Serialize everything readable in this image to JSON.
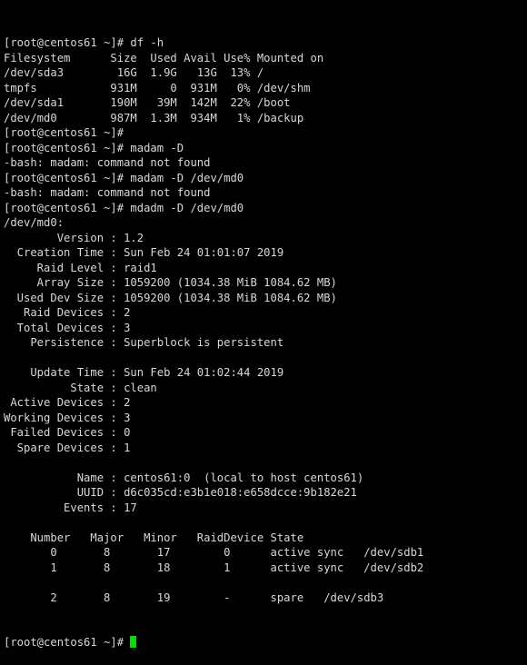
{
  "terminal": {
    "colors": {
      "background": "#000000",
      "foreground": "#d8d8d8",
      "cursor": "#00e000"
    },
    "prompt": "[root@centos61 ~]#",
    "hostname": "centos61",
    "user": "root",
    "lines": [
      "[root@centos61 ~]# df -h",
      "Filesystem      Size  Used Avail Use% Mounted on",
      "/dev/sda3        16G  1.9G   13G  13% /",
      "tmpfs           931M     0  931M   0% /dev/shm",
      "/dev/sda1       190M   39M  142M  22% /boot",
      "/dev/md0        987M  1.3M  934M   1% /backup",
      "[root@centos61 ~]#",
      "[root@centos61 ~]# madam -D",
      "-bash: madam: command not found",
      "[root@centos61 ~]# madam -D /dev/md0",
      "-bash: madam: command not found",
      "[root@centos61 ~]# mdadm -D /dev/md0",
      "/dev/md0:",
      "        Version : 1.2",
      "  Creation Time : Sun Feb 24 01:01:07 2019",
      "     Raid Level : raid1",
      "     Array Size : 1059200 (1034.38 MiB 1084.62 MB)",
      "  Used Dev Size : 1059200 (1034.38 MiB 1084.62 MB)",
      "   Raid Devices : 2",
      "  Total Devices : 3",
      "    Persistence : Superblock is persistent",
      "",
      "    Update Time : Sun Feb 24 01:02:44 2019",
      "          State : clean",
      " Active Devices : 2",
      "Working Devices : 3",
      " Failed Devices : 0",
      "  Spare Devices : 1",
      "",
      "           Name : centos61:0  (local to host centos61)",
      "           UUID : d6c035cd:e3b1e018:e658dcce:9b182e21",
      "         Events : 17",
      "",
      "    Number   Major   Minor   RaidDevice State",
      "       0       8       17        0      active sync   /dev/sdb1",
      "       1       8       18        1      active sync   /dev/sdb2",
      "",
      "       2       8       19        -      spare   /dev/sdb3"
    ],
    "final_prompt": "[root@centos61 ~]# ",
    "commands": [
      "df -h",
      "madam -D",
      "madam -D /dev/md0",
      "mdadm -D /dev/md0"
    ],
    "errors": [
      "-bash: madam: command not found",
      "-bash: madam: command not found"
    ],
    "df_output": {
      "headers": [
        "Filesystem",
        "Size",
        "Used",
        "Avail",
        "Use%",
        "Mounted on"
      ],
      "rows": [
        {
          "filesystem": "/dev/sda3",
          "size": "16G",
          "used": "1.9G",
          "avail": "13G",
          "use_pct": "13%",
          "mounted_on": "/"
        },
        {
          "filesystem": "tmpfs",
          "size": "931M",
          "used": "0",
          "avail": "931M",
          "use_pct": "0%",
          "mounted_on": "/dev/shm"
        },
        {
          "filesystem": "/dev/sda1",
          "size": "190M",
          "used": "39M",
          "avail": "142M",
          "use_pct": "22%",
          "mounted_on": "/boot"
        },
        {
          "filesystem": "/dev/md0",
          "size": "987M",
          "used": "1.3M",
          "avail": "934M",
          "use_pct": "1%",
          "mounted_on": "/backup"
        }
      ]
    },
    "mdadm_detail": {
      "device": "/dev/md0:",
      "version": "1.2",
      "creation_time": "Sun Feb 24 01:01:07 2019",
      "raid_level": "raid1",
      "array_size": "1059200 (1034.38 MiB 1084.62 MB)",
      "used_dev_size": "1059200 (1034.38 MiB 1084.62 MB)",
      "raid_devices": "2",
      "total_devices": "3",
      "persistence": "Superblock is persistent",
      "update_time": "Sun Feb 24 01:02:44 2019",
      "state": "clean",
      "active_devices": "2",
      "working_devices": "3",
      "failed_devices": "0",
      "spare_devices": "1",
      "name": "centos61:0  (local to host centos61)",
      "uuid": "d6c035cd:e3b1e018:e658dcce:9b182e21",
      "events": "17",
      "device_table": {
        "headers": [
          "Number",
          "Major",
          "Minor",
          "RaidDevice",
          "State"
        ],
        "rows": [
          {
            "number": "0",
            "major": "8",
            "minor": "17",
            "raid_device": "0",
            "state": "active sync",
            "path": "/dev/sdb1"
          },
          {
            "number": "1",
            "major": "8",
            "minor": "18",
            "raid_device": "1",
            "state": "active sync",
            "path": "/dev/sdb2"
          },
          {
            "number": "2",
            "major": "8",
            "minor": "19",
            "raid_device": "-",
            "state": "spare",
            "path": "/dev/sdb3"
          }
        ]
      }
    }
  }
}
